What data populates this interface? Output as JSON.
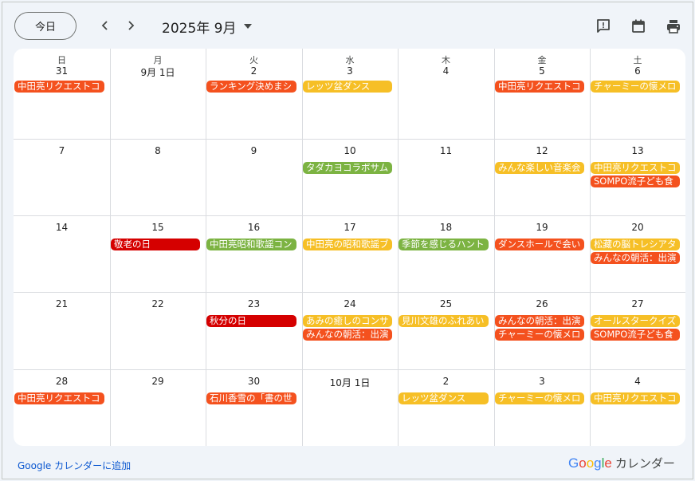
{
  "toolbar": {
    "today_label": "今日",
    "prev_icon": "chevron-left-icon",
    "next_icon": "chevron-right-icon",
    "month_title": "2025年 9月",
    "dropdown_icon": "caret-down-icon",
    "icons": [
      "feedback-icon",
      "calendar-icon",
      "print-icon"
    ]
  },
  "colors": {
    "orange": "#f4511e",
    "yellow": "#f6bf26",
    "green": "#7cb342",
    "red": "#d50000",
    "background": "#f0f4f9",
    "grid_line": "#dadce0",
    "link": "#0b57d0"
  },
  "weekdays": [
    "日",
    "月",
    "火",
    "水",
    "木",
    "金",
    "土"
  ],
  "weeks": [
    {
      "days": [
        {
          "label": "31",
          "events": [
            {
              "title": "中田亮リクエストコ",
              "color": "orange"
            }
          ]
        },
        {
          "label": "9月 1日",
          "events": []
        },
        {
          "label": "2",
          "events": [
            {
              "title": "ランキング決めまシ",
              "color": "orange"
            }
          ]
        },
        {
          "label": "3",
          "events": [
            {
              "title": "レッツ盆ダンス",
              "color": "yellow"
            }
          ]
        },
        {
          "label": "4",
          "events": []
        },
        {
          "label": "5",
          "events": [
            {
              "title": "中田亮リクエストコ",
              "color": "orange"
            }
          ]
        },
        {
          "label": "6",
          "events": [
            {
              "title": "チャーミーの懐メロ",
              "color": "yellow"
            }
          ]
        }
      ]
    },
    {
      "days": [
        {
          "label": "7",
          "events": []
        },
        {
          "label": "8",
          "events": []
        },
        {
          "label": "9",
          "events": []
        },
        {
          "label": "10",
          "events": [
            {
              "title": "タダカヨコラボサム",
              "color": "green"
            }
          ]
        },
        {
          "label": "11",
          "events": []
        },
        {
          "label": "12",
          "events": [
            {
              "title": "みんな楽しい音楽会",
              "color": "yellow"
            }
          ]
        },
        {
          "label": "13",
          "events": [
            {
              "title": "中田亮リクエストコ",
              "color": "yellow"
            },
            {
              "title": "SOMPO流子ども食",
              "color": "orange"
            }
          ]
        }
      ]
    },
    {
      "days": [
        {
          "label": "14",
          "events": []
        },
        {
          "label": "15",
          "events": [
            {
              "title": "敬老の日",
              "color": "red"
            }
          ]
        },
        {
          "label": "16",
          "events": [
            {
              "title": "中田亮昭和歌謡コン",
              "color": "green"
            }
          ]
        },
        {
          "label": "17",
          "events": [
            {
              "title": "中田亮の昭和歌謡ブ",
              "color": "yellow"
            }
          ]
        },
        {
          "label": "18",
          "events": [
            {
              "title": "季節を感じるハント",
              "color": "green"
            }
          ]
        },
        {
          "label": "19",
          "events": [
            {
              "title": "ダンスホールで会い",
              "color": "orange"
            }
          ]
        },
        {
          "label": "20",
          "events": [
            {
              "title": "松藏の脳トレシアタ",
              "color": "yellow"
            },
            {
              "title": "みんなの朝活：出演",
              "color": "orange"
            }
          ]
        }
      ]
    },
    {
      "days": [
        {
          "label": "21",
          "events": []
        },
        {
          "label": "22",
          "events": []
        },
        {
          "label": "23",
          "events": [
            {
              "title": "秋分の日",
              "color": "red"
            }
          ]
        },
        {
          "label": "24",
          "events": [
            {
              "title": "あみの癒しのコンサ",
              "color": "yellow"
            },
            {
              "title": "みんなの朝活：出演",
              "color": "orange"
            }
          ]
        },
        {
          "label": "25",
          "events": [
            {
              "title": "見川文雄のふれあい",
              "color": "yellow"
            }
          ]
        },
        {
          "label": "26",
          "events": [
            {
              "title": "みんなの朝活：出演",
              "color": "orange"
            },
            {
              "title": "チャーミーの懐メロ",
              "color": "orange"
            }
          ]
        },
        {
          "label": "27",
          "events": [
            {
              "title": "オールスタークイズ",
              "color": "yellow"
            },
            {
              "title": "SOMPO流子ども食",
              "color": "orange"
            }
          ]
        }
      ]
    },
    {
      "days": [
        {
          "label": "28",
          "events": [
            {
              "title": "中田亮リクエストコ",
              "color": "orange"
            }
          ]
        },
        {
          "label": "29",
          "events": []
        },
        {
          "label": "30",
          "events": [
            {
              "title": "石川香雪の「書の世",
              "color": "orange"
            }
          ]
        },
        {
          "label": "10月 1日",
          "events": []
        },
        {
          "label": "2",
          "events": [
            {
              "title": "レッツ盆ダンス",
              "color": "yellow"
            }
          ]
        },
        {
          "label": "3",
          "events": [
            {
              "title": "チャーミーの懐メロ",
              "color": "yellow"
            }
          ]
        },
        {
          "label": "4",
          "events": [
            {
              "title": "中田亮リクエストコ",
              "color": "yellow"
            }
          ]
        }
      ]
    }
  ],
  "footer": {
    "add_link": "Google カレンダーに追加",
    "brand_google": "Google",
    "brand_calendar": "カレンダー"
  }
}
